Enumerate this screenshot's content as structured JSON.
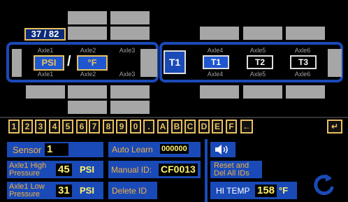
{
  "counter": "37 / 82",
  "axles_left_top": [
    "Axle1",
    "Axle2",
    "Axle3"
  ],
  "axles_left_bottom": [
    "Axle1",
    "Axle2",
    "Axle3"
  ],
  "axles_right_top": [
    "Axle4",
    "Axle5",
    "Axle6"
  ],
  "axles_right_bottom": [
    "Axle4",
    "Axle5",
    "Axle6"
  ],
  "units": {
    "pressure": "PSI",
    "slash": "/",
    "temp": "°F"
  },
  "trailer_buttons": {
    "main": "T1",
    "t1": "T1",
    "t2": "T2",
    "t3": "T3"
  },
  "keypad": [
    "1",
    "2",
    "3",
    "4",
    "5",
    "6",
    "7",
    "8",
    "9",
    "0",
    ".",
    "A",
    "B",
    "C",
    "D",
    "E",
    "F",
    "←",
    "↵"
  ],
  "controls": {
    "sensor_label": "Sensor",
    "sensor_value": "1",
    "auto_learn_label": "Auto Learn",
    "auto_learn_value": "000000",
    "axle1_high_label_1": "Axle1 High",
    "axle1_high_label_2": "Pressure",
    "axle1_high_value": "45",
    "axle1_high_unit": "PSI",
    "manual_id_label": "Manual ID:",
    "manual_id_value": "CF0013",
    "axle1_low_label_1": "Axle1 Low",
    "axle1_low_label_2": "Pressure",
    "axle1_low_value": "31",
    "axle1_low_unit": "PSI",
    "delete_id_label": "Delete ID",
    "reset_label_1": "Reset and",
    "reset_label_2": "Del All IDs",
    "hi_temp_label": "HI TEMP",
    "hi_temp_value": "158",
    "hi_temp_unit": "°F",
    "sound_icon": "speaker-icon",
    "refresh_icon": "refresh-icon"
  },
  "colors": {
    "accent": "#e8c060",
    "panel_blue": "#1a4ab8",
    "tire_gray": "#a6a6a6"
  }
}
